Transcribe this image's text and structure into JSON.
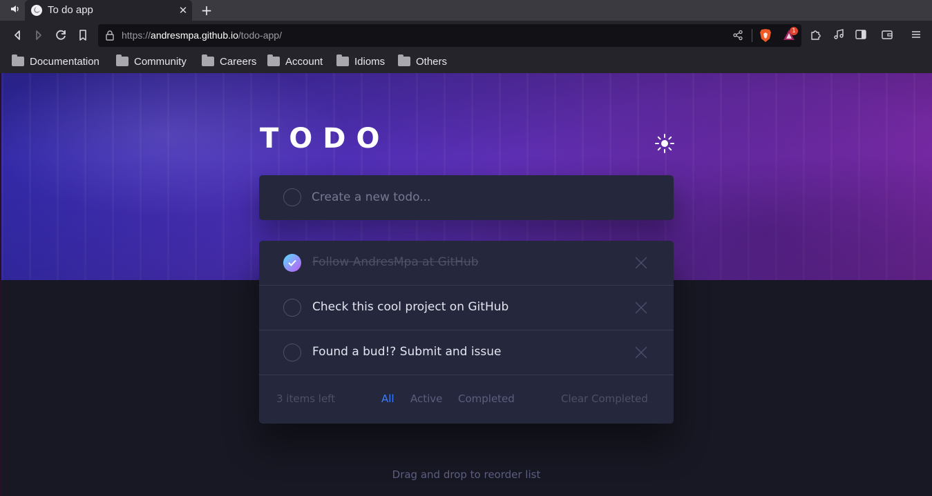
{
  "browser": {
    "tab": {
      "title": "To do app",
      "close_glyph": "✕"
    },
    "new_tab_glyph": "+",
    "url": {
      "scheme": "https://",
      "host": "andresmpa.github.io",
      "path": "/todo-app/"
    },
    "rewards_badge": "1",
    "bookmarks": [
      "Documentation",
      "Community",
      "Careers",
      "Account",
      "Idioms",
      "Others"
    ],
    "icons": {
      "audio": "speaker-icon",
      "back": "back-arrow-icon",
      "forward": "forward-arrow-icon",
      "reload": "reload-icon",
      "bookmark": "bookmark-icon",
      "lock": "lock-icon",
      "share": "share-icon",
      "brave": "brave-shields-icon",
      "rewards": "brave-rewards-icon",
      "extensions": "puzzle-icon",
      "media": "music-note-icon",
      "sidebar": "sidebar-icon",
      "wallet": "wallet-icon",
      "menu": "hamburger-menu-icon"
    }
  },
  "app": {
    "title": "TODO",
    "theme_toggle_icon": "sun-icon",
    "new_todo": {
      "placeholder": "Create a new todo..."
    },
    "todos": [
      {
        "text": "Follow AndresMpa at GitHub",
        "completed": true
      },
      {
        "text": "Check this cool project on GitHub",
        "completed": false
      },
      {
        "text": "Found a bud!? Submit and issue",
        "completed": false
      }
    ],
    "footer": {
      "items_left": "3 items left",
      "filters": [
        "All",
        "Active",
        "Completed"
      ],
      "active_filter": "All",
      "clear_completed": "Clear Completed"
    },
    "hint": "Drag and drop to reorder list"
  },
  "colors": {
    "page_bg": "#181824",
    "card_bg": "#25273c",
    "active_filter": "#3a7cfd",
    "check_gradient_start": "#57ddff",
    "check_gradient_end": "#c058f3"
  }
}
